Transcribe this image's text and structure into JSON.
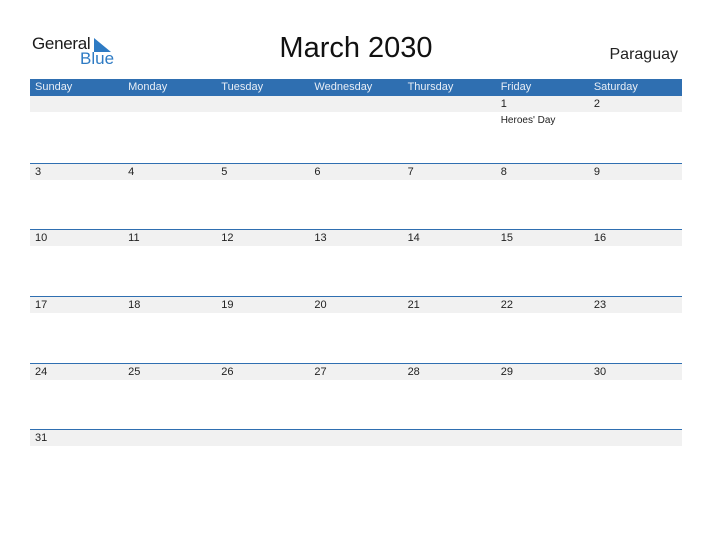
{
  "logo": {
    "general": "General",
    "blue": "Blue",
    "accent_color": "#2e7bc4"
  },
  "title": "March 2030",
  "country": "Paraguay",
  "colors": {
    "header_bg": "#2f6fb1",
    "row_band": "#f1f1f1"
  },
  "weekdays": [
    "Sunday",
    "Monday",
    "Tuesday",
    "Wednesday",
    "Thursday",
    "Friday",
    "Saturday"
  ],
  "weeks": [
    {
      "days": [
        {
          "num": "",
          "event": ""
        },
        {
          "num": "",
          "event": ""
        },
        {
          "num": "",
          "event": ""
        },
        {
          "num": "",
          "event": ""
        },
        {
          "num": "",
          "event": ""
        },
        {
          "num": "1",
          "event": "Heroes' Day"
        },
        {
          "num": "2",
          "event": ""
        }
      ]
    },
    {
      "days": [
        {
          "num": "3",
          "event": ""
        },
        {
          "num": "4",
          "event": ""
        },
        {
          "num": "5",
          "event": ""
        },
        {
          "num": "6",
          "event": ""
        },
        {
          "num": "7",
          "event": ""
        },
        {
          "num": "8",
          "event": ""
        },
        {
          "num": "9",
          "event": ""
        }
      ]
    },
    {
      "days": [
        {
          "num": "10",
          "event": ""
        },
        {
          "num": "11",
          "event": ""
        },
        {
          "num": "12",
          "event": ""
        },
        {
          "num": "13",
          "event": ""
        },
        {
          "num": "14",
          "event": ""
        },
        {
          "num": "15",
          "event": ""
        },
        {
          "num": "16",
          "event": ""
        }
      ]
    },
    {
      "days": [
        {
          "num": "17",
          "event": ""
        },
        {
          "num": "18",
          "event": ""
        },
        {
          "num": "19",
          "event": ""
        },
        {
          "num": "20",
          "event": ""
        },
        {
          "num": "21",
          "event": ""
        },
        {
          "num": "22",
          "event": ""
        },
        {
          "num": "23",
          "event": ""
        }
      ]
    },
    {
      "days": [
        {
          "num": "24",
          "event": ""
        },
        {
          "num": "25",
          "event": ""
        },
        {
          "num": "26",
          "event": ""
        },
        {
          "num": "27",
          "event": ""
        },
        {
          "num": "28",
          "event": ""
        },
        {
          "num": "29",
          "event": ""
        },
        {
          "num": "30",
          "event": ""
        }
      ]
    },
    {
      "days": [
        {
          "num": "31",
          "event": ""
        },
        {
          "num": "",
          "event": ""
        },
        {
          "num": "",
          "event": ""
        },
        {
          "num": "",
          "event": ""
        },
        {
          "num": "",
          "event": ""
        },
        {
          "num": "",
          "event": ""
        },
        {
          "num": "",
          "event": ""
        }
      ]
    }
  ]
}
